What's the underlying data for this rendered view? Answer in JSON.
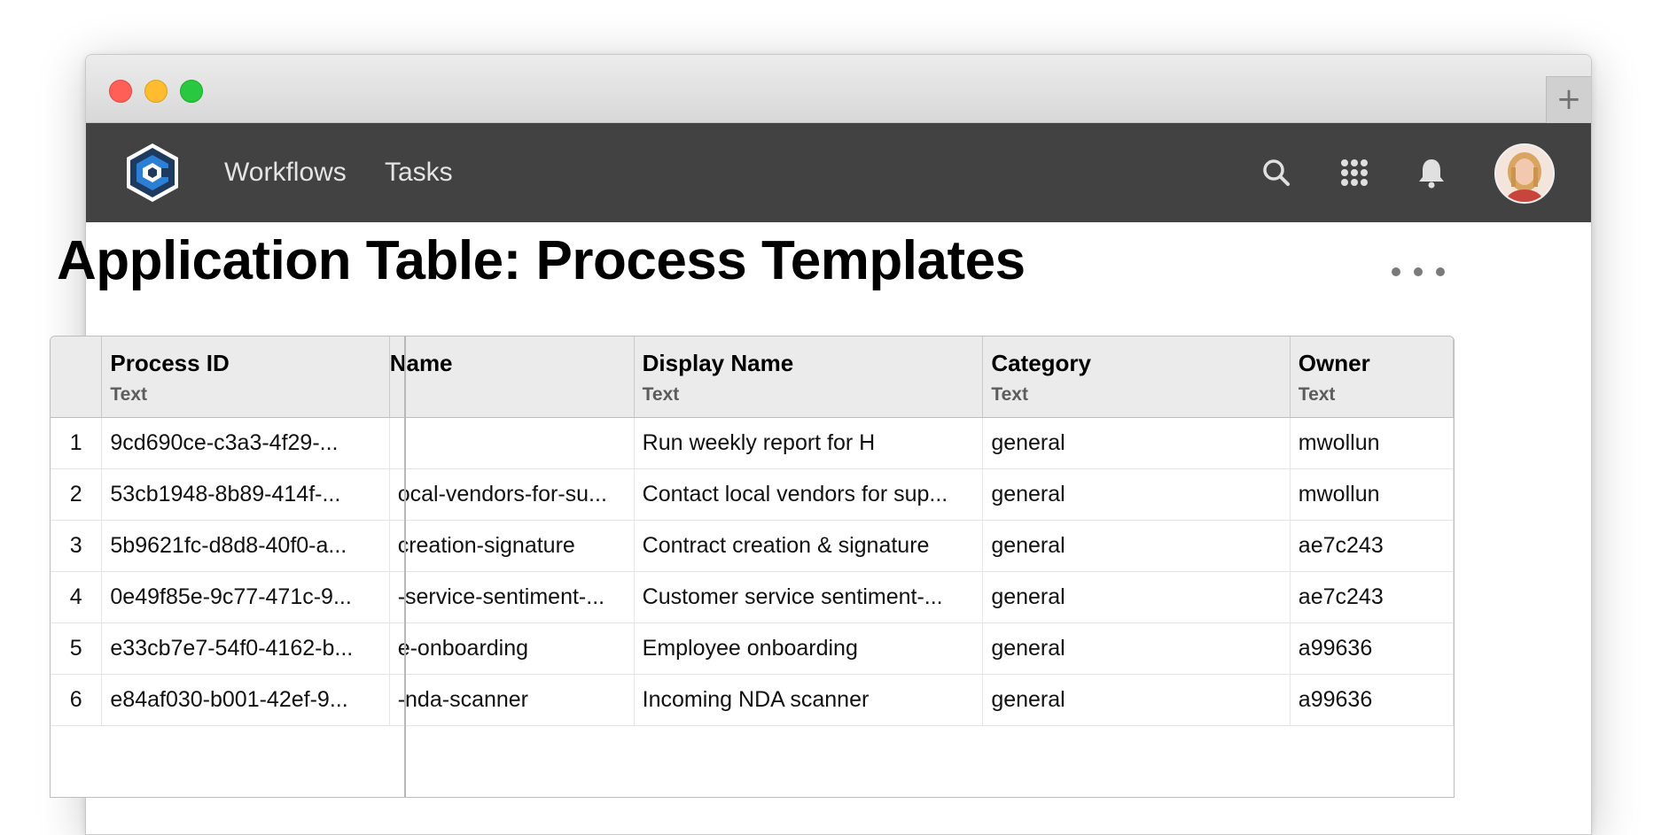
{
  "window": {
    "new_tab_label": "+"
  },
  "nav": {
    "links": [
      "Workflows",
      "Tasks"
    ],
    "icons": [
      "search-icon",
      "apps-grid-icon",
      "bell-icon"
    ]
  },
  "page": {
    "title": "Application Table: Process Templates"
  },
  "table": {
    "columns": [
      {
        "title": "Process ID",
        "type": "Text"
      },
      {
        "title": "Name",
        "type": ""
      },
      {
        "title": "Display Name",
        "type": "Text"
      },
      {
        "title": "Category",
        "type": "Text"
      },
      {
        "title": "Owner",
        "type": "Text"
      }
    ],
    "rows": [
      {
        "index": "1",
        "process_id": "9cd690ce-c3a3-4f29-...",
        "name": "",
        "display_name": "Run weekly report for H",
        "category": "general",
        "owner": "mwollun"
      },
      {
        "index": "2",
        "process_id": "53cb1948-8b89-414f-...",
        "name": "ocal-vendors-for-su...",
        "display_name": "Contact local vendors for sup...",
        "category": "general",
        "owner": "mwollun"
      },
      {
        "index": "3",
        "process_id": "5b9621fc-d8d8-40f0-a...",
        "name": "creation-signature",
        "display_name": "Contract creation & signature",
        "category": "general",
        "owner": "ae7c243"
      },
      {
        "index": "4",
        "process_id": "0e49f85e-9c77-471c-9...",
        "name": "-service-sentiment-...",
        "display_name": "Customer service sentiment-...",
        "category": "general",
        "owner": "ae7c243"
      },
      {
        "index": "5",
        "process_id": "e33cb7e7-54f0-4162-b...",
        "name": "e-onboarding",
        "display_name": "Employee onboarding",
        "category": "general",
        "owner": "a99636"
      },
      {
        "index": "6",
        "process_id": "e84af030-b001-42ef-9...",
        "name": "-nda-scanner",
        "display_name": "Incoming NDA scanner",
        "category": "general",
        "owner": "a99636"
      }
    ]
  },
  "colors": {
    "navbar": "#424242",
    "header_bg": "#ebebeb",
    "logo_blue": "#2b7fd4",
    "logo_dark": "#1e3a5f"
  }
}
